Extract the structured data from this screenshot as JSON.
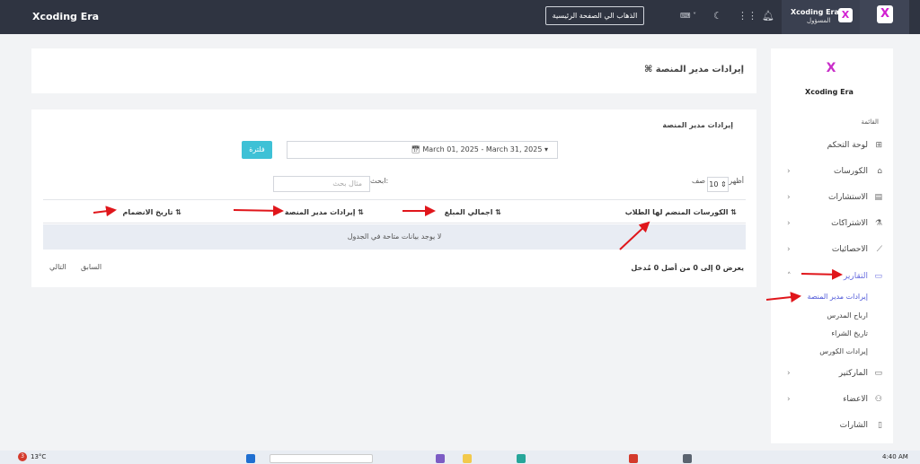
{
  "topbar": {
    "brand": "Xcoding Era",
    "home_button": "الذهاب الي الصفحة الرئيسية",
    "user_name": "Xcoding Era",
    "user_role": "المسؤول",
    "logo_letter": "X"
  },
  "sidebar": {
    "brand": "Xcoding Era",
    "section": "القائمة",
    "items": [
      {
        "label": "لوحة التحكم",
        "icon": "⊞",
        "chevron": ""
      },
      {
        "label": "الكورسات",
        "icon": "⌂",
        "chevron": "›"
      },
      {
        "label": "الاستشارات",
        "icon": "▤",
        "chevron": "›"
      },
      {
        "label": "الاشتراكات",
        "icon": "⚗",
        "chevron": "›"
      },
      {
        "label": "الاحصائيات",
        "icon": "⟋",
        "chevron": "›"
      },
      {
        "label": "التقارير",
        "icon": "▭",
        "chevron": "˄"
      },
      {
        "label": "الماركتير",
        "icon": "▭",
        "chevron": "›"
      },
      {
        "label": "الاعضاء",
        "icon": "⚇",
        "chevron": "›"
      },
      {
        "label": "الشارات",
        "icon": "▯",
        "chevron": ""
      }
    ],
    "sub_items": [
      "إيرادات مدير المنصة",
      "ارباح المدرس",
      "تاريخ الشراء",
      "إيرادات الكورس"
    ]
  },
  "page": {
    "title": "⌘ إيرادات مدير المنصة",
    "card_title": "إيرادات مدير المنصة",
    "date_range": "March 01, 2025 - March 31, 2025",
    "filter_label": "فلترة",
    "show_label": "أظهر",
    "page_size": "10",
    "rows_label": "صف",
    "search_label": "ابحث:",
    "search_placeholder": "مثال بحث",
    "columns": [
      "الكورسات المنضم لها الطلاب",
      "اجمالي المبلغ",
      "إيرادات مدير المنصة",
      "تاريخ الانضمام"
    ],
    "empty_message": "لا يوجد بيانات متاحة في الجدول",
    "info": "يعرض 0 إلى 0 من أصل 0 مُدخل",
    "prev": "السابق",
    "next": "التالي"
  },
  "taskbar": {
    "temperature": "13°C",
    "notifications": "3",
    "time": "4:40 AM"
  },
  "colors": {
    "topbar": "#2f3441",
    "accent": "#3ec1d6",
    "active": "#4d57d8",
    "annotation": "#e0161b"
  }
}
